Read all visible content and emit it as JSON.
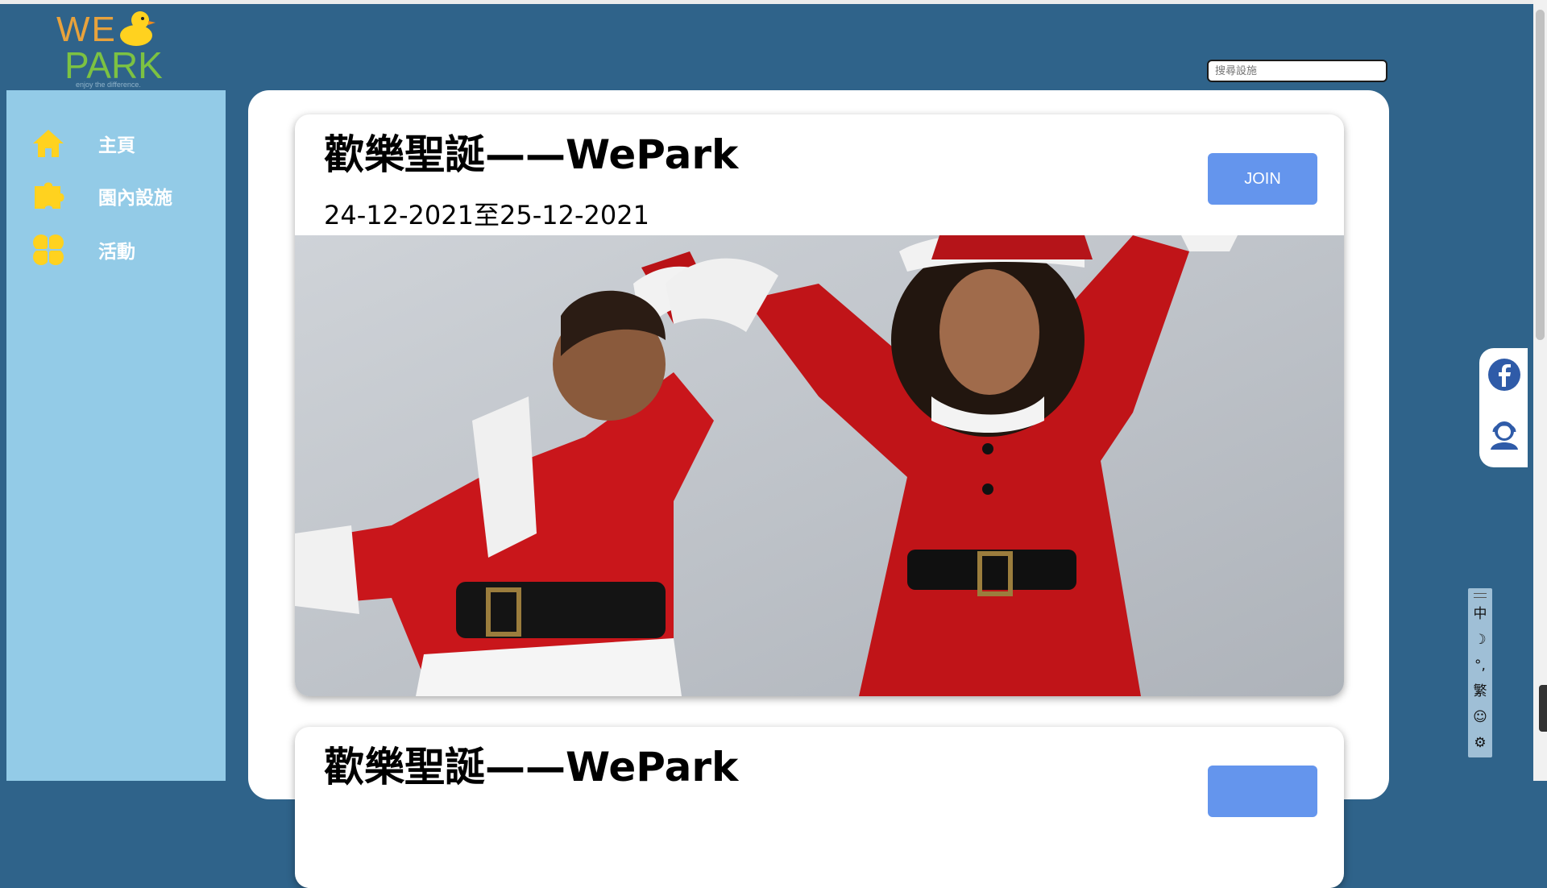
{
  "logo": {
    "line1": "WE",
    "line2": "PARK",
    "tagline": "enjoy the difference."
  },
  "search": {
    "placeholder": "搜尋設施"
  },
  "sidebar": {
    "items": [
      {
        "label": "主頁",
        "icon": "home-icon"
      },
      {
        "label": "園內設施",
        "icon": "puzzle-icon"
      },
      {
        "label": "活動",
        "icon": "clover-icon"
      }
    ]
  },
  "events": [
    {
      "title": "歡樂聖誕——WePark",
      "date": "24-12-2021至25-12-2021",
      "button": "JOIN"
    },
    {
      "title": "歡樂聖誕——WePark",
      "date": "",
      "button": ""
    }
  ],
  "social": {
    "items": [
      "facebook-icon",
      "support-agent-icon"
    ]
  },
  "toolbar": {
    "items": [
      "中",
      "☽",
      "°,",
      "繁",
      "☺",
      "⚙"
    ]
  },
  "colors": {
    "background": "#2f638a",
    "sidebar": "#93cbe7",
    "icon_yellow": "#ffd21f",
    "join_button": "#6495ed"
  }
}
